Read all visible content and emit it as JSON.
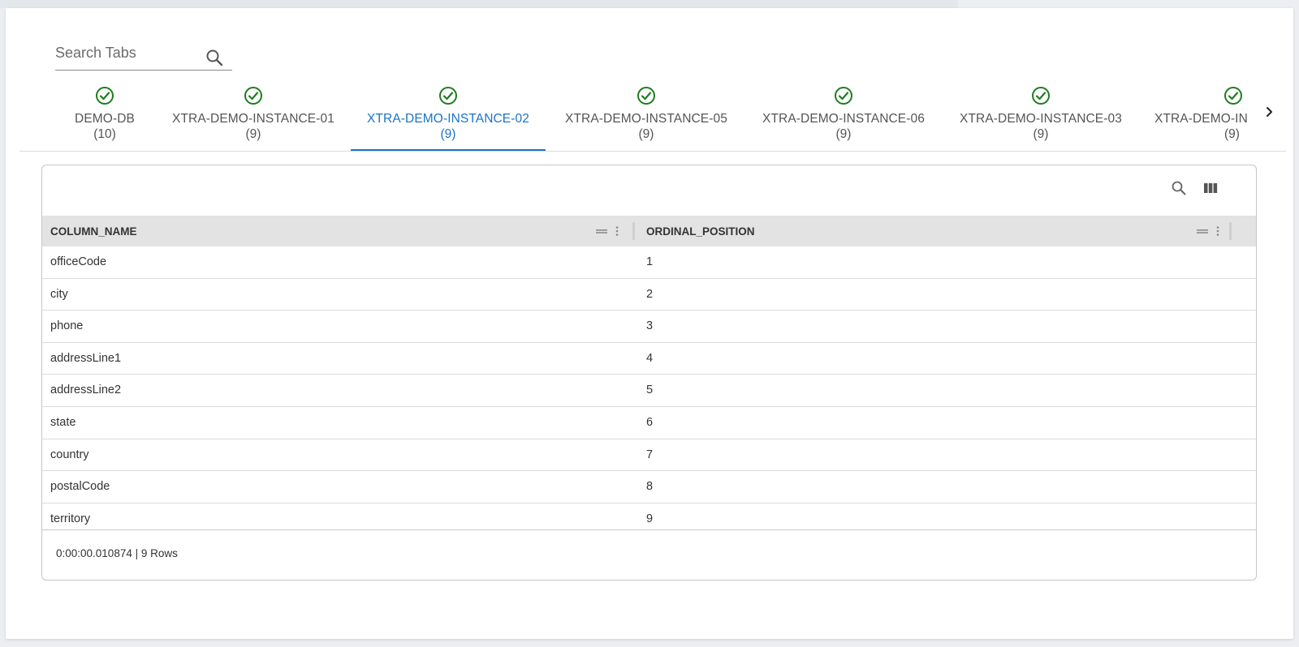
{
  "search": {
    "placeholder": "Search Tabs"
  },
  "tabs": [
    {
      "name": "DEMO-DB",
      "count": "(10)",
      "active": false
    },
    {
      "name": "XTRA-DEMO-INSTANCE-01",
      "count": "(9)",
      "active": false
    },
    {
      "name": "XTRA-DEMO-INSTANCE-02",
      "count": "(9)",
      "active": true
    },
    {
      "name": "XTRA-DEMO-INSTANCE-05",
      "count": "(9)",
      "active": false
    },
    {
      "name": "XTRA-DEMO-INSTANCE-06",
      "count": "(9)",
      "active": false
    },
    {
      "name": "XTRA-DEMO-INSTANCE-03",
      "count": "(9)",
      "active": false
    },
    {
      "name": "XTRA-DEMO-IN",
      "count": "(9)",
      "active": false
    }
  ],
  "grid": {
    "columns": [
      "COLUMN_NAME",
      "ORDINAL_POSITION"
    ],
    "rows": [
      [
        "officeCode",
        "1"
      ],
      [
        "city",
        "2"
      ],
      [
        "phone",
        "3"
      ],
      [
        "addressLine1",
        "4"
      ],
      [
        "addressLine2",
        "5"
      ],
      [
        "state",
        "6"
      ],
      [
        "country",
        "7"
      ],
      [
        "postalCode",
        "8"
      ],
      [
        "territory",
        "9"
      ]
    ],
    "footer": "0:00:00.010874 | 9 Rows"
  },
  "colors": {
    "accent": "#1a73c7",
    "success": "#1e7d1e",
    "header_bg": "#e3e3e3"
  },
  "icons": {
    "tab_status": "check-circle-icon",
    "search": "search-icon",
    "columns": "columns-icon",
    "scroll_right": "chevron-right-icon",
    "drag": "drag-handle-icon",
    "menu": "more-vert-icon"
  }
}
